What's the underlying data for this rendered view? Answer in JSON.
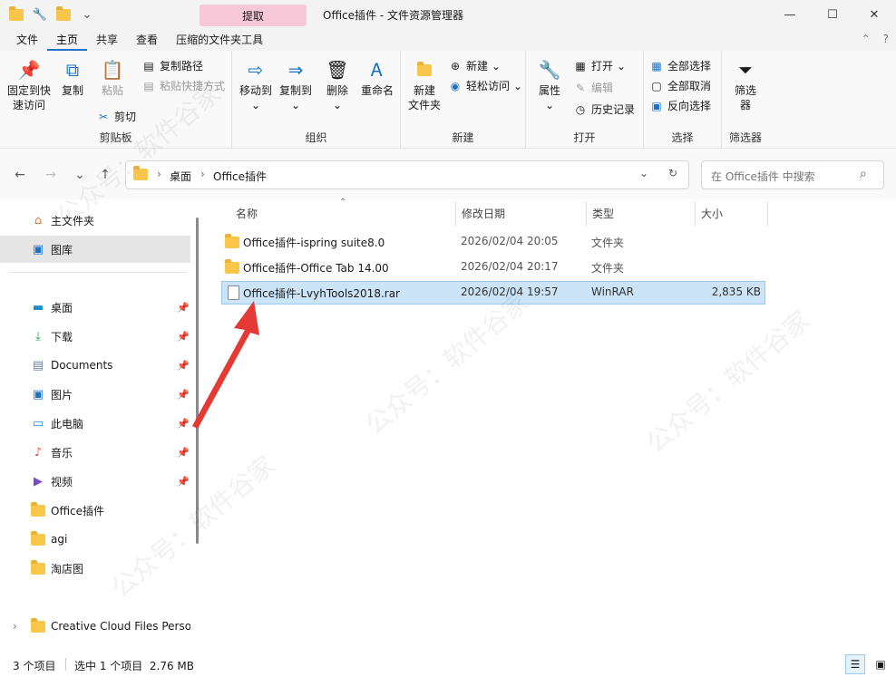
{
  "window": {
    "title": "Office插件 - 文件资源管理器",
    "context_tab": "提取",
    "minimize_glyph": "—",
    "maximize_glyph": "☐",
    "close_glyph": "✕"
  },
  "ribbon_tabs": [
    "文件",
    "主页",
    "共享",
    "查看",
    "压缩的文件夹工具"
  ],
  "ribbon": {
    "clipboard": {
      "pin": "固定到快\n速访问",
      "copy": "复制",
      "paste": "粘贴",
      "copy_path": "复制路径",
      "paste_shortcut": "粘贴快捷方式",
      "cut": "剪切",
      "group": "剪贴板"
    },
    "organize": {
      "move_to": "移动到",
      "copy_to": "复制到",
      "delete": "删除",
      "rename": "重命名",
      "group": "组织"
    },
    "new": {
      "new_folder": "新建\n文件夹",
      "new_item": "新建",
      "easy_access": "轻松访问",
      "group": "新建"
    },
    "open": {
      "properties": "属性",
      "open": "打开",
      "edit": "编辑",
      "history": "历史记录",
      "group": "打开"
    },
    "select": {
      "select_all": "全部选择",
      "select_none": "全部取消",
      "invert": "反向选择",
      "group": "选择"
    },
    "filter": {
      "label": "筛选\n器",
      "group": "筛选器"
    }
  },
  "address": {
    "crumbs": [
      "桌面",
      "Office插件"
    ],
    "search_placeholder": "在 Office插件 中搜索"
  },
  "sidebar": {
    "top": [
      {
        "label": "主文件夹"
      },
      {
        "label": "图库"
      }
    ],
    "pinned": [
      {
        "label": "桌面",
        "icon": "desktop-icon"
      },
      {
        "label": "下载",
        "icon": "download-icon"
      },
      {
        "label": "Documents",
        "icon": "documents-icon"
      },
      {
        "label": "图片",
        "icon": "pictures-icon"
      },
      {
        "label": "此电脑",
        "icon": "this-pc-icon"
      },
      {
        "label": "音乐",
        "icon": "music-icon"
      },
      {
        "label": "视频",
        "icon": "video-icon"
      }
    ],
    "folders": [
      {
        "label": "Office插件"
      },
      {
        "label": "agi"
      },
      {
        "label": "淘店图"
      }
    ],
    "cloud": "Creative Cloud Files Perso"
  },
  "columns": {
    "name": "名称",
    "date": "修改日期",
    "type": "类型",
    "size": "大小"
  },
  "files": [
    {
      "name": "Office插件-ispring suite8.0",
      "date": "2026/02/04 20:05",
      "type": "文件夹",
      "size": "",
      "kind": "folder",
      "selected": false
    },
    {
      "name": "Office插件-Office Tab 14.00",
      "date": "2026/02/04 20:17",
      "type": "文件夹",
      "size": "",
      "kind": "folder",
      "selected": false
    },
    {
      "name": "Office插件-LvyhTools2018.rar",
      "date": "2026/02/04 19:57",
      "type": "WinRAR",
      "size": "2,835 KB",
      "kind": "file",
      "selected": true
    }
  ],
  "status": {
    "count": "3 个项目",
    "selection": "选中 1 个项目  2.76 MB"
  },
  "watermark": "公众号：软件谷家",
  "colors": {
    "accent": "#1a73c8",
    "selection": "#cce4f7",
    "arrow": "#e53935",
    "context_tab": "#f6c8d8"
  }
}
